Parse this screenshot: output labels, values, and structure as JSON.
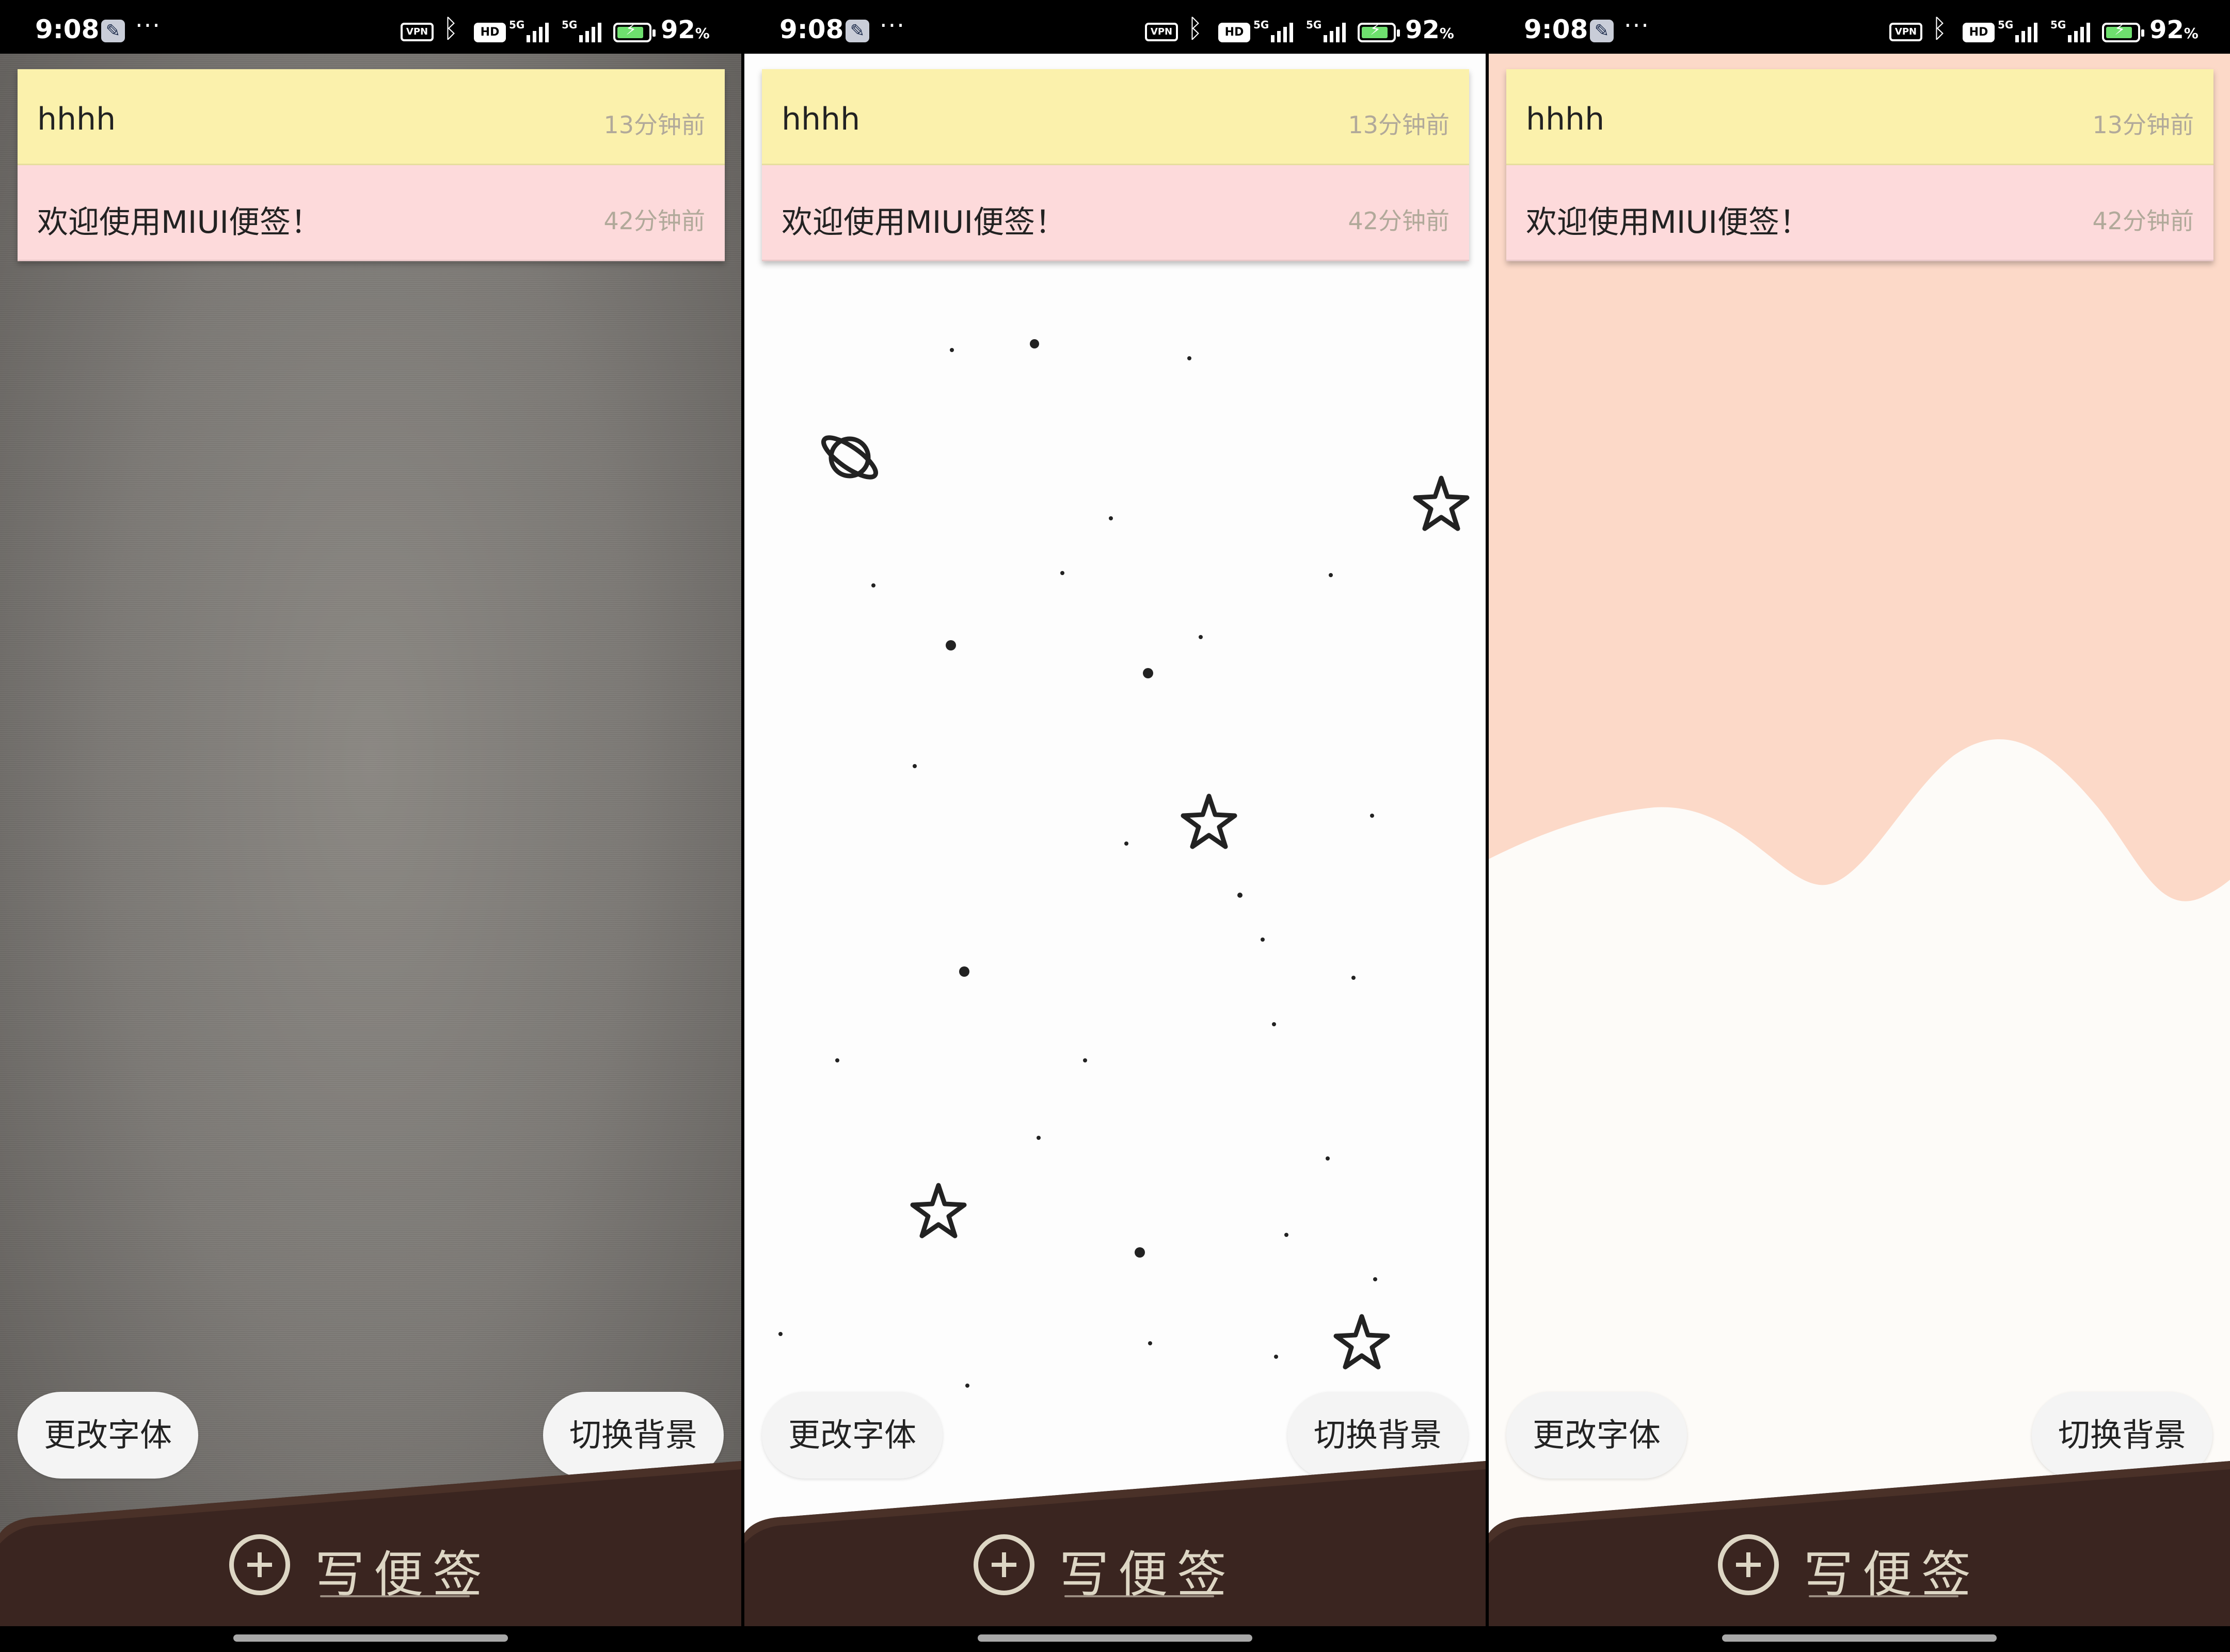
{
  "status_bar": {
    "time": "9:08",
    "vpn": "VPN",
    "hd": "HD",
    "signal_label": "5G",
    "battery_percent": "92",
    "battery_unit": "%"
  },
  "notes": [
    {
      "title": "hhhh",
      "time": "13分钟前",
      "color": "#fbf1ac"
    },
    {
      "title": "欢迎使用MIUI便签！",
      "time": "42分钟前",
      "color": "#fddadb"
    }
  ],
  "buttons": {
    "change_font": "更改字体",
    "switch_background": "切换背景"
  },
  "write_note_label": "写便签",
  "panels": [
    {
      "background": "gray-texture",
      "color": "#7d7a76"
    },
    {
      "background": "white-stars",
      "color": "#fdfdfd"
    },
    {
      "background": "peach-wave",
      "color": "#fcd9c8"
    }
  ],
  "colors": {
    "leather": "#3a2520",
    "write_label": "#ddd6c4"
  }
}
